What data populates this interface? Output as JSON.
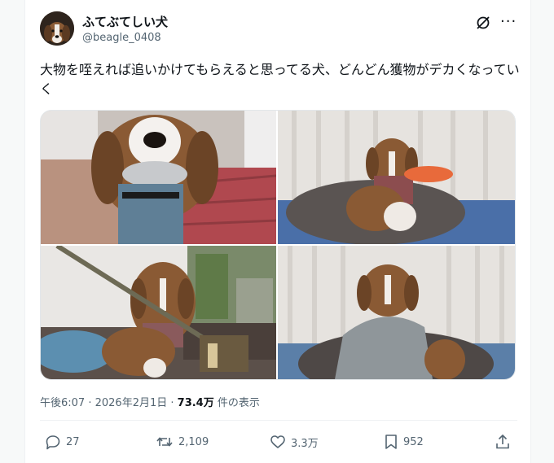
{
  "author": {
    "display_name": "ふてぶてしい犬",
    "handle": "@beagle_0408"
  },
  "tweet": {
    "text": "大物を咥えれば追いかけてもらえると思ってる犬、どんどん獲物がデカくなっていく"
  },
  "media": {
    "count": 4,
    "items": [
      {
        "subject": "beagle with scrunchie in mouth"
      },
      {
        "subject": "beagle carrying orange bowl"
      },
      {
        "subject": "beagle carrying broom"
      },
      {
        "subject": "beagle carrying gray blanket"
      }
    ]
  },
  "meta": {
    "time": "午後6:07",
    "separator": " · ",
    "date": "2026年2月1日",
    "views": "73.4万",
    "views_suffix": " 件の表示"
  },
  "actions": {
    "replies": "27",
    "reposts": "2,109",
    "likes": "3.3万",
    "bookmarks": "952"
  },
  "icons": [
    "grok-icon",
    "more-icon",
    "reply-icon",
    "repost-icon",
    "like-icon",
    "bookmark-icon",
    "share-icon"
  ],
  "colors": {
    "secondary_text": "#536471",
    "primary_text": "#0f1419",
    "border": "#eef1f3"
  }
}
